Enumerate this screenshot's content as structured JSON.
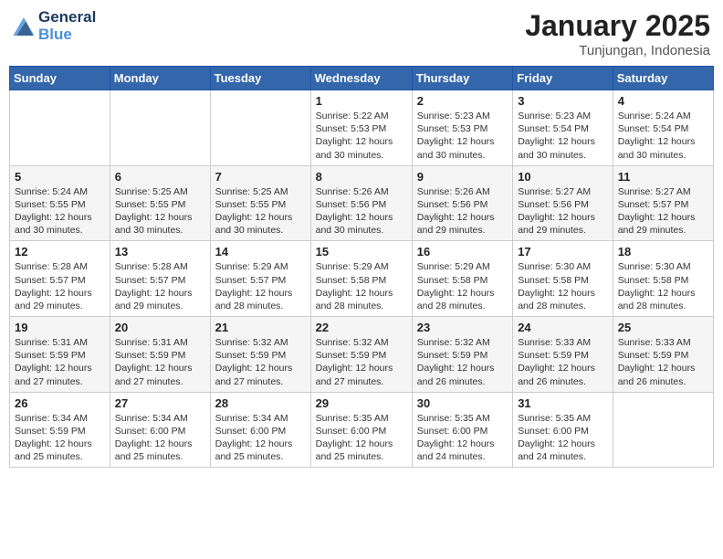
{
  "header": {
    "logo_line1": "General",
    "logo_line2": "Blue",
    "month": "January 2025",
    "location": "Tunjungan, Indonesia"
  },
  "weekdays": [
    "Sunday",
    "Monday",
    "Tuesday",
    "Wednesday",
    "Thursday",
    "Friday",
    "Saturday"
  ],
  "weeks": [
    [
      {
        "day": "",
        "info": ""
      },
      {
        "day": "",
        "info": ""
      },
      {
        "day": "",
        "info": ""
      },
      {
        "day": "1",
        "info": "Sunrise: 5:22 AM\nSunset: 5:53 PM\nDaylight: 12 hours\nand 30 minutes."
      },
      {
        "day": "2",
        "info": "Sunrise: 5:23 AM\nSunset: 5:53 PM\nDaylight: 12 hours\nand 30 minutes."
      },
      {
        "day": "3",
        "info": "Sunrise: 5:23 AM\nSunset: 5:54 PM\nDaylight: 12 hours\nand 30 minutes."
      },
      {
        "day": "4",
        "info": "Sunrise: 5:24 AM\nSunset: 5:54 PM\nDaylight: 12 hours\nand 30 minutes."
      }
    ],
    [
      {
        "day": "5",
        "info": "Sunrise: 5:24 AM\nSunset: 5:55 PM\nDaylight: 12 hours\nand 30 minutes."
      },
      {
        "day": "6",
        "info": "Sunrise: 5:25 AM\nSunset: 5:55 PM\nDaylight: 12 hours\nand 30 minutes."
      },
      {
        "day": "7",
        "info": "Sunrise: 5:25 AM\nSunset: 5:55 PM\nDaylight: 12 hours\nand 30 minutes."
      },
      {
        "day": "8",
        "info": "Sunrise: 5:26 AM\nSunset: 5:56 PM\nDaylight: 12 hours\nand 30 minutes."
      },
      {
        "day": "9",
        "info": "Sunrise: 5:26 AM\nSunset: 5:56 PM\nDaylight: 12 hours\nand 29 minutes."
      },
      {
        "day": "10",
        "info": "Sunrise: 5:27 AM\nSunset: 5:56 PM\nDaylight: 12 hours\nand 29 minutes."
      },
      {
        "day": "11",
        "info": "Sunrise: 5:27 AM\nSunset: 5:57 PM\nDaylight: 12 hours\nand 29 minutes."
      }
    ],
    [
      {
        "day": "12",
        "info": "Sunrise: 5:28 AM\nSunset: 5:57 PM\nDaylight: 12 hours\nand 29 minutes."
      },
      {
        "day": "13",
        "info": "Sunrise: 5:28 AM\nSunset: 5:57 PM\nDaylight: 12 hours\nand 29 minutes."
      },
      {
        "day": "14",
        "info": "Sunrise: 5:29 AM\nSunset: 5:57 PM\nDaylight: 12 hours\nand 28 minutes."
      },
      {
        "day": "15",
        "info": "Sunrise: 5:29 AM\nSunset: 5:58 PM\nDaylight: 12 hours\nand 28 minutes."
      },
      {
        "day": "16",
        "info": "Sunrise: 5:29 AM\nSunset: 5:58 PM\nDaylight: 12 hours\nand 28 minutes."
      },
      {
        "day": "17",
        "info": "Sunrise: 5:30 AM\nSunset: 5:58 PM\nDaylight: 12 hours\nand 28 minutes."
      },
      {
        "day": "18",
        "info": "Sunrise: 5:30 AM\nSunset: 5:58 PM\nDaylight: 12 hours\nand 28 minutes."
      }
    ],
    [
      {
        "day": "19",
        "info": "Sunrise: 5:31 AM\nSunset: 5:59 PM\nDaylight: 12 hours\nand 27 minutes."
      },
      {
        "day": "20",
        "info": "Sunrise: 5:31 AM\nSunset: 5:59 PM\nDaylight: 12 hours\nand 27 minutes."
      },
      {
        "day": "21",
        "info": "Sunrise: 5:32 AM\nSunset: 5:59 PM\nDaylight: 12 hours\nand 27 minutes."
      },
      {
        "day": "22",
        "info": "Sunrise: 5:32 AM\nSunset: 5:59 PM\nDaylight: 12 hours\nand 27 minutes."
      },
      {
        "day": "23",
        "info": "Sunrise: 5:32 AM\nSunset: 5:59 PM\nDaylight: 12 hours\nand 26 minutes."
      },
      {
        "day": "24",
        "info": "Sunrise: 5:33 AM\nSunset: 5:59 PM\nDaylight: 12 hours\nand 26 minutes."
      },
      {
        "day": "25",
        "info": "Sunrise: 5:33 AM\nSunset: 5:59 PM\nDaylight: 12 hours\nand 26 minutes."
      }
    ],
    [
      {
        "day": "26",
        "info": "Sunrise: 5:34 AM\nSunset: 5:59 PM\nDaylight: 12 hours\nand 25 minutes."
      },
      {
        "day": "27",
        "info": "Sunrise: 5:34 AM\nSunset: 6:00 PM\nDaylight: 12 hours\nand 25 minutes."
      },
      {
        "day": "28",
        "info": "Sunrise: 5:34 AM\nSunset: 6:00 PM\nDaylight: 12 hours\nand 25 minutes."
      },
      {
        "day": "29",
        "info": "Sunrise: 5:35 AM\nSunset: 6:00 PM\nDaylight: 12 hours\nand 25 minutes."
      },
      {
        "day": "30",
        "info": "Sunrise: 5:35 AM\nSunset: 6:00 PM\nDaylight: 12 hours\nand 24 minutes."
      },
      {
        "day": "31",
        "info": "Sunrise: 5:35 AM\nSunset: 6:00 PM\nDaylight: 12 hours\nand 24 minutes."
      },
      {
        "day": "",
        "info": ""
      }
    ]
  ]
}
